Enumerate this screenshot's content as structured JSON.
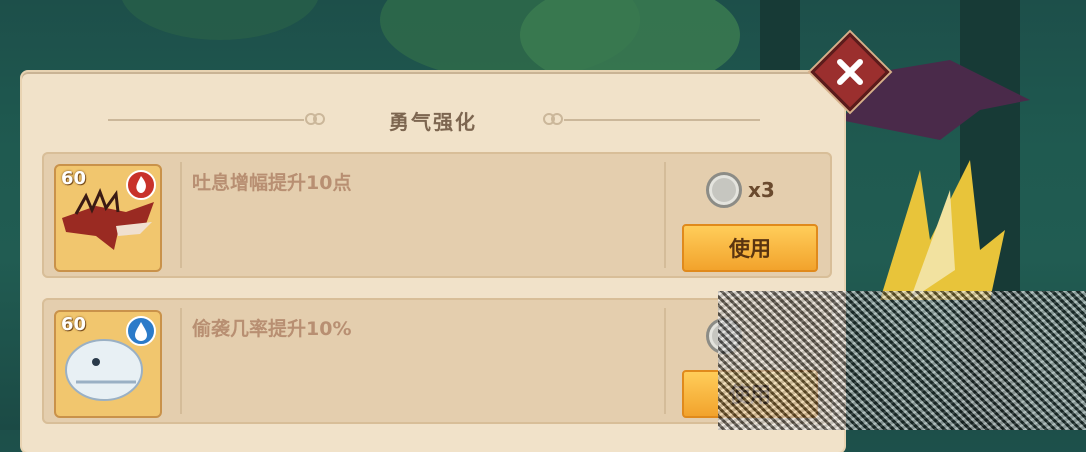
{
  "header": {
    "title": "勇气强化"
  },
  "close_icon": "close-x-icon",
  "items": [
    {
      "level": "60",
      "element_icon": "fire-icon",
      "element_color": "#c8322a",
      "description": "吐息增幅提升10点",
      "cost_icon": "silver-coin-icon",
      "cost": "x3",
      "button_label": "使用"
    },
    {
      "level": "60",
      "element_icon": "water-drop-icon",
      "element_color": "#2b7bc9",
      "description": "偷袭几率提升10%",
      "cost_icon": "silver-coin-icon",
      "cost": "",
      "button_label": "使用"
    }
  ],
  "colors": {
    "panel": "#f1e2c9",
    "card": "#e4ceae",
    "button": "#f2a32c",
    "close": "#9b2f2e"
  }
}
